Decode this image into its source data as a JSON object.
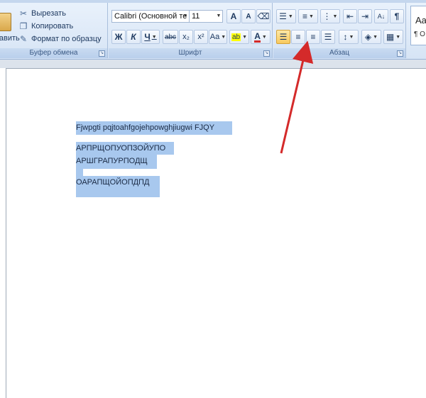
{
  "clipboard": {
    "paste_label": "тавить",
    "cut_label": "Вырезать",
    "copy_label": "Копировать",
    "format_painter_label": "Формат по образцу",
    "group_label": "Буфер обмена"
  },
  "font": {
    "family_value": "Calibri (Основной те",
    "size_value": "11",
    "grow_label": "A",
    "shrink_label": "A",
    "clear_label": "",
    "bold_label": "Ж",
    "italic_label": "К",
    "underline_label": "Ч",
    "strike_label": "abc",
    "subscript_label": "x₂",
    "superscript_label": "x²",
    "case_label": "Aa",
    "highlight_label": "ab",
    "color_label": "A",
    "group_label": "Шрифт"
  },
  "paragraph": {
    "group_label": "Абзац",
    "show_marks_label": "¶",
    "sort_label": "А↓Я"
  },
  "styles": {
    "preview_text": "Aa",
    "preview_sub": "¶ О"
  },
  "document": {
    "lines": [
      "Fjwpgti pqjtoahfgojehpowghjiugwi FJQY",
      "АРПРЩОПУОПЗОЙУПО",
      "АРШГРАПУРПОДЩ",
      "ОАРАПЩОЙОПДПД"
    ]
  },
  "colors": {
    "selection": "#a8c8ee",
    "arrow": "#d42a2a",
    "ribbon": "#dfe9f6"
  }
}
